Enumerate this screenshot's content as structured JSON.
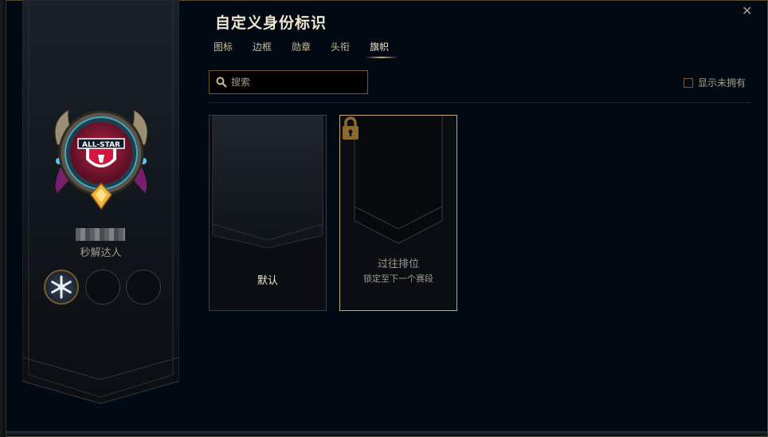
{
  "header": {
    "title": "自定义身份标识",
    "close_glyph": "✕"
  },
  "tabs": [
    {
      "label": "图标",
      "active": false
    },
    {
      "label": "边框",
      "active": false
    },
    {
      "label": "勋章",
      "active": false
    },
    {
      "label": "头衔",
      "active": false
    },
    {
      "label": "旗帜",
      "active": true
    }
  ],
  "search": {
    "placeholder": "搜索",
    "value": ""
  },
  "filter": {
    "show_unowned_label": "显示未拥有",
    "checked": false
  },
  "profile": {
    "title": "秒解达人",
    "emblem_text": "ALL-STAR",
    "slots": [
      {
        "filled": true,
        "icon": "snowflake-badge-icon"
      },
      {
        "filled": false
      },
      {
        "filled": false
      }
    ]
  },
  "banners": [
    {
      "label": "默认",
      "subtitle": "",
      "locked": false
    },
    {
      "label": "过往排位",
      "subtitle": "锁定至下一个赛段",
      "locked": true,
      "icon": "lock-icon"
    }
  ],
  "colors": {
    "background": "#010a13",
    "gold": "#c8aa6e",
    "text_gold": "#cdbe91",
    "text_muted": "#a09b8c"
  }
}
